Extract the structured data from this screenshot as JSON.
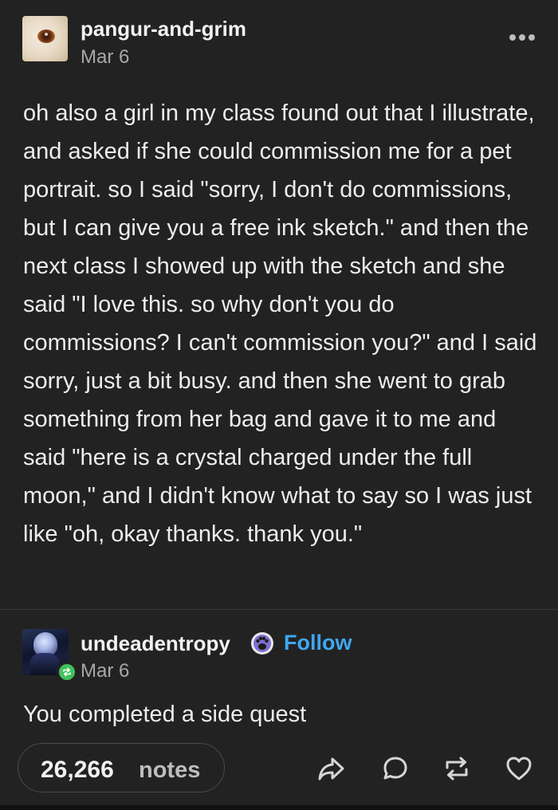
{
  "post": {
    "username": "pangur-and-grim",
    "date": "Mar 6",
    "body": "oh also a girl in my class found out that I illustrate, and asked if she could commission me for a pet portrait. so I said \"sorry, I don't do commissions, but I can give you a free ink sketch.\" and then the next class I showed up with the sketch and she said \"I love this. so why don't you do commissions? I can't commission you?\" and I said sorry, just a bit busy. and then she went to grab something from her bag and gave it to me and said \"here is a crystal charged under the full moon,\" and I didn't know what to say so I was just like \"oh, okay thanks. thank you.\""
  },
  "reblog": {
    "username": "undeadentropy",
    "follow_label": "Follow",
    "date": "Mar 6",
    "text": "You completed a side quest"
  },
  "footer": {
    "notes_count": "26,266",
    "notes_label": "notes"
  },
  "icons": [
    "more-icon",
    "reblog-badge-icon",
    "paw-badge-icon",
    "share-icon",
    "reply-icon",
    "reblog-icon",
    "heart-icon"
  ],
  "colors": {
    "background": "#222222",
    "follow": "#3fa7f2",
    "reblog_badge": "#41c25d",
    "text": "#ededed",
    "muted": "#a8a8a8"
  }
}
